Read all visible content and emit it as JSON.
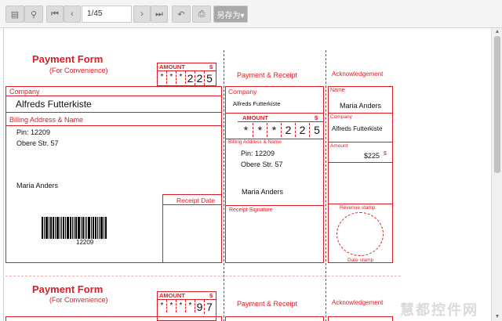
{
  "toolbar": {
    "page_value": "1/45",
    "save_as_label": "另存为▾"
  },
  "form1": {
    "title": "Payment Form",
    "subtitle": "(For Convenience)",
    "amount_label": "AMOUNT",
    "currency": "$",
    "amount_digits": [
      "*",
      "*",
      "*",
      "2",
      "2",
      "5"
    ],
    "company_label": "Company",
    "company_value": "Alfreds Futterkiste",
    "billing_label": "Billing Address & Name",
    "pin": "Pin: 12209",
    "street": "Obere Str. 57",
    "name": "Maria Anders",
    "barcode_value": "12209",
    "receipt_date_label": "Receipt Date",
    "receipt_title": "Payment & Receipt",
    "receipt_company_label": "Company",
    "receipt_company_value": "Alfreds Futterkiste",
    "receipt_amount_label": "AMOUNT",
    "receipt_currency": "$",
    "receipt_digits": [
      "*",
      "*",
      "*",
      "2",
      "2",
      "5"
    ],
    "receipt_billing_label": "Billing Address & Name",
    "receipt_pin": "Pin: 12209",
    "receipt_street": "Obere Str. 57",
    "receipt_name": "Maria Anders",
    "receipt_signature_label": "Receipt Signature",
    "ack_title": "Acknowledgement",
    "ack_name_label": "Name",
    "ack_name_value": "Maria Anders",
    "ack_company_label": "Company",
    "ack_company_value": "Alfreds Futterkiste",
    "ack_amount_label": "Amount",
    "ack_amount_value": "$225",
    "ack_currency": "$",
    "revenue_stamp_label": "Revenue stamp",
    "date_stamp_label": "Date stamp"
  },
  "form2": {
    "title": "Payment Form",
    "subtitle": "(For Convenience)",
    "amount_label": "AMOUNT",
    "currency": "$",
    "amount_digits": [
      "*",
      "*",
      "*",
      "*",
      "9",
      "7"
    ],
    "receipt_title": "Payment & Receipt",
    "ack_title": "Acknowledgement"
  },
  "watermark": "慧都控件网"
}
